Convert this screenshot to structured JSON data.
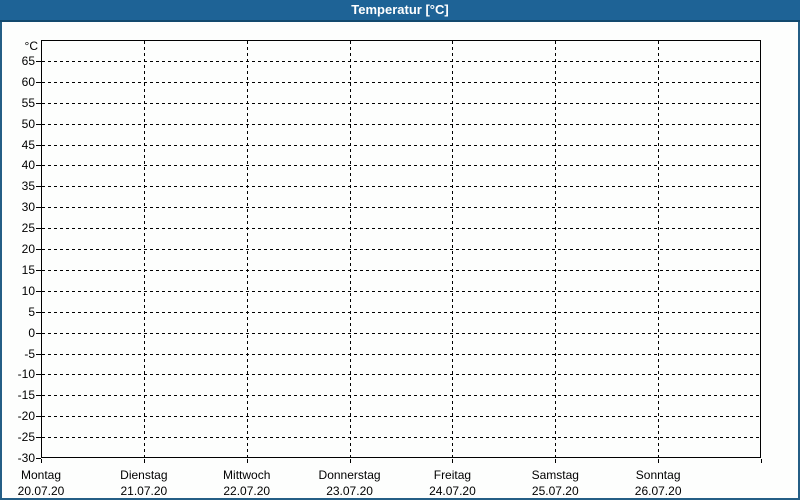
{
  "window": {
    "title": "Temperatur [°C]"
  },
  "colors": {
    "titlebar_bg": "#1e6396",
    "titlebar_edge": "#12496e",
    "frame_border": "#245e85",
    "background": "#fdfefd",
    "grid": "#000000",
    "label_text": "#000000",
    "title_text": "#ffffff"
  },
  "chart_data": {
    "type": "line",
    "title": "Temperatur [°C]",
    "xlabel": "",
    "ylabel": "°C",
    "ylim": [
      -30,
      70
    ],
    "y_tick_step": 5,
    "y_ticks": [
      65,
      60,
      55,
      50,
      45,
      40,
      35,
      30,
      25,
      20,
      15,
      10,
      5,
      0,
      -5,
      -10,
      -15,
      -20,
      -25,
      -30
    ],
    "grid": "dashed",
    "days": [
      {
        "name": "Montag",
        "date": "20.07.20"
      },
      {
        "name": "Dienstag",
        "date": "21.07.20"
      },
      {
        "name": "Mittwoch",
        "date": "22.07.20"
      },
      {
        "name": "Donnerstag",
        "date": "23.07.20"
      },
      {
        "name": "Freitag",
        "date": "24.07.20"
      },
      {
        "name": "Samstag",
        "date": "25.07.20"
      },
      {
        "name": "Sonntag",
        "date": "26.07.20"
      }
    ],
    "series": []
  }
}
